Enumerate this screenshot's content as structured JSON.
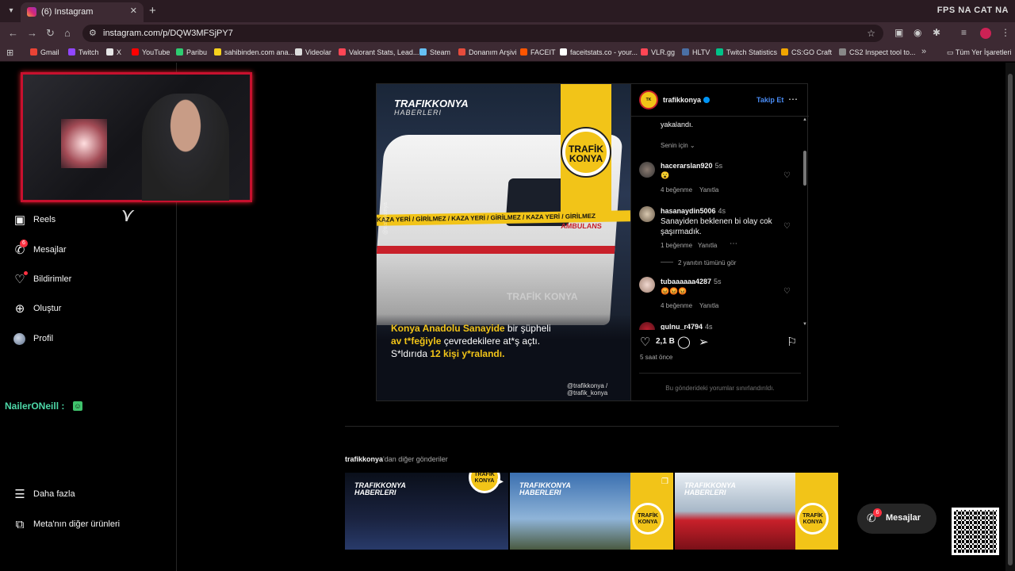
{
  "browser": {
    "tab_title": "(6) Instagram",
    "url": "instagram.com/p/DQW3MFSjPY7",
    "overlay_text": "FPS NA   CAT NA",
    "bookmarks": [
      {
        "label": "Gmail",
        "color": "#ea4335"
      },
      {
        "label": "Twitch",
        "color": "#9146ff"
      },
      {
        "label": "X",
        "color": "#e6e6e6"
      },
      {
        "label": "YouTube",
        "color": "#ff0000"
      },
      {
        "label": "Paribu",
        "color": "#2ecc71"
      },
      {
        "label": "sahibinden.com ana...",
        "color": "#f8d21d"
      },
      {
        "label": "Videolar",
        "color": "#dddddd"
      },
      {
        "label": "Valorant Stats, Lead...",
        "color": "#ff4655"
      },
      {
        "label": "Steam",
        "color": "#66c0f4"
      },
      {
        "label": "Donanım Arşivi",
        "color": "#e74c3c"
      },
      {
        "label": "FACEIT",
        "color": "#ff5500"
      },
      {
        "label": "faceitstats.co - your...",
        "color": "#ffffff"
      },
      {
        "label": "VLR.gg",
        "color": "#ff4655"
      },
      {
        "label": "HLTV",
        "color": "#4a6fa5"
      },
      {
        "label": "Twitch Statistics",
        "color": "#00c389"
      },
      {
        "label": "CS:GO Craft",
        "color": "#f0a500"
      },
      {
        "label": "CS2 Inspect tool to...",
        "color": "#888888"
      }
    ],
    "bookmarks_all": "Tüm Yer İşaretleri"
  },
  "sidebar": {
    "items": [
      {
        "label": "Reels",
        "icon": "reels-icon"
      },
      {
        "label": "Mesajlar",
        "icon": "messenger-icon",
        "badge": "6"
      },
      {
        "label": "Bildirimler",
        "icon": "heart-icon"
      },
      {
        "label": "Oluştur",
        "icon": "plus-square-icon"
      },
      {
        "label": "Profil",
        "icon": "avatar-icon"
      }
    ],
    "more": "Daha fazla",
    "meta": "Meta'nın diğer ürünleri"
  },
  "chat": {
    "name": "NailerONeill :"
  },
  "post": {
    "image": {
      "brand": "TRAFIKKONYA",
      "brand_sub": "HABERLERI",
      "logo_text": "TRAFİK KONYA",
      "tape_text": "KAZA YERİ / GİRİLMEZ / KAZA YERİ / GİRİLMEZ / KAZA YERİ / GİRİLMEZ",
      "ambulance_text": "AMBULANS",
      "watermark": "TRAFİK KONYA",
      "side_watermark": "@trafikkonya",
      "caption_1_y": "Konya Anadolu Sanayide",
      "caption_1_w": " bir şüpheli",
      "caption_2_y": "av t*feğiyle",
      "caption_2_w": " çevredekilere at*ş açtı.",
      "caption_3_w": "S*ldırıda ",
      "caption_3_y": "12 kişi y*ralandı.",
      "social": "@trafikkonya / @trafik_konya"
    },
    "username": "trafikkonya",
    "follow": "Takip Et",
    "comments_top": "yakalandı.",
    "for_you": "Senin için",
    "comments": [
      {
        "user": "hacerarslan920",
        "time": "5s",
        "text": "😮",
        "likes": "4 beğenme",
        "reply": "Yanıtla"
      },
      {
        "user": "hasanaydin5006",
        "time": "4s",
        "text": "Sanayiden beklenen bi olay cok şaşırmadık.",
        "likes": "1 beğenme",
        "reply": "Yanıtla",
        "view_replies": "2 yanıtın tümünü gör"
      },
      {
        "user": "tubaaaaaa4287",
        "time": "5s",
        "text": "😡😡😡",
        "likes": "4 beğenme",
        "reply": "Yanıtla"
      },
      {
        "user": "gulnu_r4794",
        "time": "4s"
      }
    ],
    "like_count": "2,1 B",
    "time_ago": "5 saat önce",
    "comments_limited": "Bu gönderideki yorumlar sınırlandırıldı."
  },
  "more_posts": {
    "title_user": "trafikkonya",
    "title_rest": "'dan diğer gönderiler",
    "thumb_brand": "TRAFIKKONYA",
    "thumb_sub": "HABERLERI",
    "thumb_logo": "TRAFİK KONYA"
  },
  "messages_pill": {
    "label": "Mesajlar",
    "badge": "6"
  }
}
